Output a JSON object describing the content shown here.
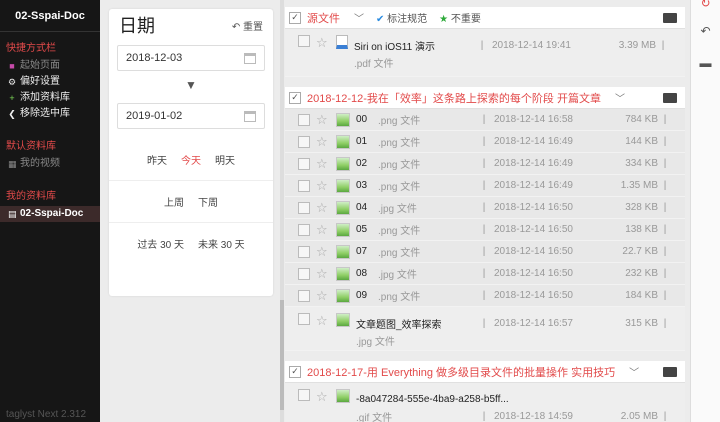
{
  "sidebar": {
    "title": "02-Sspai-Doc",
    "shortcuts_label": "快捷方式栏",
    "shortcuts": [
      {
        "label": "起始页面",
        "icon": "start-page-icon"
      },
      {
        "label": "偏好设置",
        "icon": "gear-icon"
      },
      {
        "label": "添加资料库",
        "icon": "plus-icon"
      },
      {
        "label": "移除选中库",
        "icon": "chevron-left-icon"
      }
    ],
    "default_lib_label": "默认资料库",
    "default_libs": [
      {
        "label": "我的视频",
        "icon": "video-icon"
      }
    ],
    "my_lib_label": "我的资料库",
    "my_libs": [
      {
        "label": "02-Sspai-Doc",
        "icon": "document-icon"
      }
    ],
    "footer": "taglyst Next   2.312"
  },
  "datepanel": {
    "title": "日期",
    "reset": "重置",
    "start_date": "2018-12-03",
    "end_date": "2019-01-02",
    "quick1": [
      "昨天",
      "今天",
      "明天"
    ],
    "quick2": [
      "上周",
      "下周"
    ],
    "quick3": [
      "过去 30 天",
      "未来 30 天"
    ]
  },
  "groups": [
    {
      "title": "源文件",
      "tags": [
        "标注规范",
        "不重要"
      ],
      "files": [
        {
          "name": "Siri on iOS11 演示",
          "type": ".pdf 文件",
          "date": "2018-12-14 19:41",
          "size": "3.39 MB"
        }
      ]
    },
    {
      "title": "2018-12-12-我在「效率」这条路上探索的每个阶段 开篇文章",
      "files": [
        {
          "name": "00",
          "type": ".png 文件",
          "date": "2018-12-14 16:58",
          "size": "784 KB"
        },
        {
          "name": "01",
          "type": ".png 文件",
          "date": "2018-12-14 16:49",
          "size": "144 KB"
        },
        {
          "name": "02",
          "type": ".png 文件",
          "date": "2018-12-14 16:49",
          "size": "334 KB"
        },
        {
          "name": "03",
          "type": ".png 文件",
          "date": "2018-12-14 16:49",
          "size": "1.35 MB"
        },
        {
          "name": "04",
          "type": ".jpg 文件",
          "date": "2018-12-14 16:50",
          "size": "328 KB"
        },
        {
          "name": "05",
          "type": ".png 文件",
          "date": "2018-12-14 16:50",
          "size": "138 KB"
        },
        {
          "name": "07",
          "type": ".png 文件",
          "date": "2018-12-14 16:50",
          "size": "22.7 KB"
        },
        {
          "name": "08",
          "type": ".jpg 文件",
          "date": "2018-12-14 16:50",
          "size": "232 KB"
        },
        {
          "name": "09",
          "type": ".png 文件",
          "date": "2018-12-14 16:50",
          "size": "184 KB"
        }
      ],
      "tall_file": {
        "name": "文章题图_效率探索",
        "type": ".jpg 文件",
        "date": "2018-12-14 16:57",
        "size": "315 KB"
      }
    },
    {
      "title": "2018-12-17-用 Everything 做多级目录文件的批量操作 实用技巧",
      "tall_file": {
        "name": "-8a047284-555e-4ba9-a258-b5ff...",
        "type": ".gif 文件",
        "date": "2018-12-18 14:59",
        "size": "2.05 MB"
      }
    }
  ],
  "colors": {
    "accent": "#e24a4a",
    "sidebar_bg": "#161616"
  }
}
